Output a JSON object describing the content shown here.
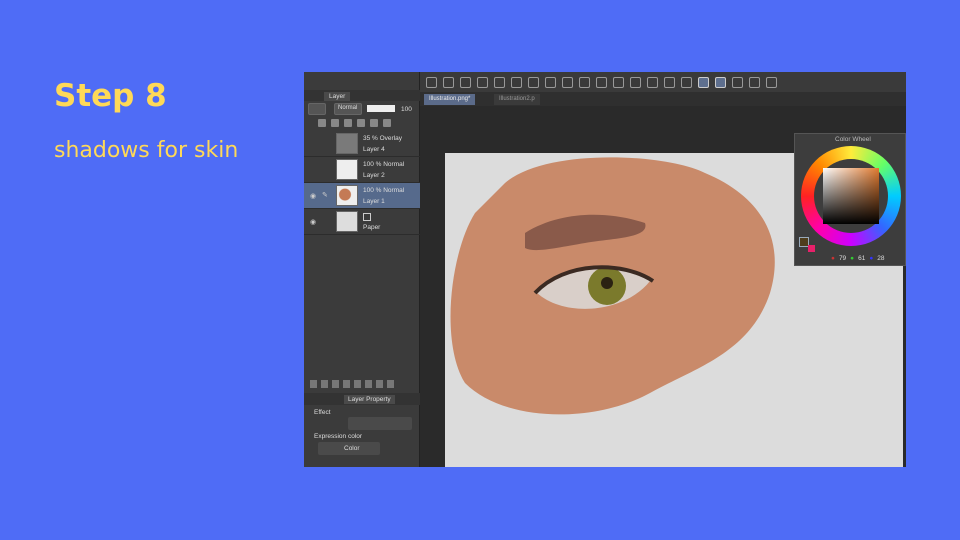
{
  "slide": {
    "title": "Step 8",
    "subtitle": "shadows for skin"
  },
  "layer_panel": {
    "tab": "Layer",
    "blend_mode": "Normal",
    "opacity": "100",
    "layers": [
      {
        "mode": "35 % Overlay",
        "name": "Layer 4",
        "visible": false,
        "selected": false
      },
      {
        "mode": "100 % Normal",
        "name": "Layer 2",
        "visible": false,
        "selected": false
      },
      {
        "mode": "100 % Normal",
        "name": "Layer 1",
        "visible": true,
        "selected": true
      },
      {
        "mode": "",
        "name": "Paper",
        "visible": true,
        "selected": false
      }
    ]
  },
  "layer_property": {
    "tab": "Layer Property",
    "effect_label": "Effect",
    "expression_label": "Expression color",
    "expression_value": "Color"
  },
  "document_tabs": [
    "Illustration.png*",
    "Illustration2.p"
  ],
  "color_wheel": {
    "title": "Color Wheel",
    "r": "79",
    "g": "61",
    "b": "28",
    "main_color": "#4f3d1c",
    "sub_color": "#e8206a"
  },
  "colors": {
    "background": "#4f6cf6",
    "accent": "#ffd957",
    "skin": "#c98a6a"
  }
}
